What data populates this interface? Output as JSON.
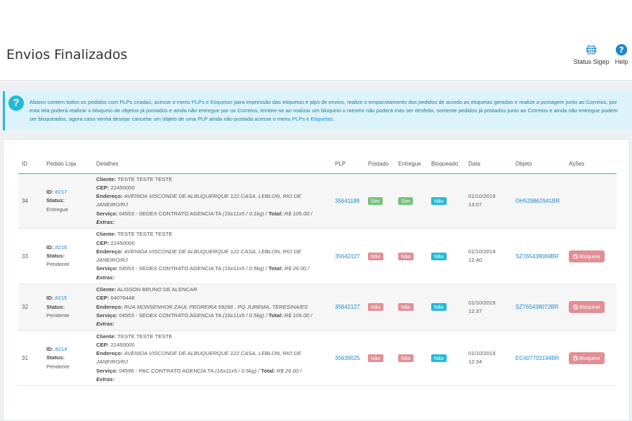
{
  "header": {
    "title": "Envios Finalizados",
    "status_sigep_label": "Status Sigep",
    "help_label": "Help"
  },
  "info": {
    "text_1": "Abaixo contem todos os pedidos com PLPs criadas, acesse o menu ",
    "link_1": "PLPs e Etiquetas",
    "text_2": " para impressão das etiquetas e plps de envios, realize o empacotamento dos pedidos de acordo as etiquetas geradas e realize a postagem junto ao Correios, por esta tela poderá realizar o bloqueio de objetos já postados e ainda não entregue por os Correios, lembre-se ao realizar um bloqueio o mesmo não poderá mas ser desfeito, somente pedidos já postados junto ao Correios e ainda não entregue podem ser bloqueados, agora caso venha desejar cancelar um objeto de uma PLP ainda não postada acesse o menu ",
    "link_2": "PLPs e Etiquetas",
    "text_3": "."
  },
  "table": {
    "headers": [
      "ID",
      "Pedido Loja",
      "Detalhes",
      "PLP",
      "Postado",
      "Entregue",
      "Bloqueado",
      "Data",
      "Objeto",
      "Ações"
    ],
    "labels": {
      "id": "ID:",
      "status": "Status:",
      "cliente": "Cliente:",
      "cep": "CEP:",
      "endereco": "Endereço:",
      "servico": "Serviço:",
      "total": "Total:",
      "extras": "Extras:"
    },
    "rows": [
      {
        "id": "34",
        "pedido": "#217",
        "status": "Entregue",
        "cliente": "TESTE TESTE TESTE",
        "cep": "22450000",
        "endereco": "AVENIDA VISCONDE DE ALBUQUERQUE 122 CASA, LEBLON, RIO DE JANEIRO/RJ",
        "servico": "04553 - SEDEX CONTRATO AGENCIA TA",
        "dims": "(16x11x5 / 0.1kg) /",
        "total": "R$ 105.00 /",
        "plp": "35641189",
        "postado": "Sim",
        "entregue": "Sim",
        "bloqueado": "Não",
        "data": "01/10/2019",
        "hora": "13:07",
        "objeto": "OH529862941BR",
        "acao": ""
      },
      {
        "id": "33",
        "pedido": "#216",
        "status": "Pendente",
        "cliente": "TESTE TESTE TESTE",
        "cep": "22450000",
        "endereco": "AVENIDA VISCONDE DE ALBUQUERQUE 122 CASA, LEBLON, RIO DE JANEIRO/RJ",
        "servico": "04553 - SEDEX CONTRATO AGENCIA TA",
        "dims": "(16x11x5 / 0.5kg) /",
        "total": "R$ 26.00 /",
        "plp": "35642127",
        "postado": "Não",
        "entregue": "Não",
        "bloqueado": "Não",
        "data": "01/10/2019",
        "hora": "12:40",
        "objeto": "SZ765438069BR",
        "acao": "Bloquear"
      },
      {
        "id": "32",
        "pedido": "#215",
        "status": "Pendente",
        "cliente": "ALISSON BRUNO DE ALENCAR",
        "cep": "64076448",
        "endereco": "RUA MONSENHOR ZAUL PEDREIRA 59266 , PQ JUREMA, TERESINA/ES",
        "servico": "04553 - SEDEX CONTRATO AGENCIA TA",
        "dims": "(16x11x5 / 0.5kg) /",
        "total": "R$ 105.00 /",
        "plp": "35642127",
        "postado": "Não",
        "entregue": "Não",
        "bloqueado": "Não",
        "data": "01/10/2019",
        "hora": "12:37",
        "objeto": "SZ765438072BR",
        "acao": "Bloquear"
      },
      {
        "id": "31",
        "pedido": "#214",
        "status": "Pendente",
        "cliente": "TESTE TESTE TESTE",
        "cep": "22450000",
        "endereco": "AVENIDA VISCONDE DE ALBUQUERQUE 122 CASA, LEBLON, RIO DE JANEIRO/RJ",
        "servico": "04596 - PAC CONTRATO AGENCIA TA",
        "dims": "(16x11x5 / 0.5kg) /",
        "total": "R$ 26.00 /",
        "plp": "35639025",
        "postado": "Não",
        "entregue": "Não",
        "bloqueado": "Não",
        "data": "01/10/2019",
        "hora": "12:34",
        "objeto": "EC407703194BR",
        "acao": "Bloquear"
      }
    ]
  },
  "colors": {
    "accent": "#25b9d7",
    "success": "#72c279",
    "danger": "#e08f95",
    "link": "#1e88c7"
  }
}
